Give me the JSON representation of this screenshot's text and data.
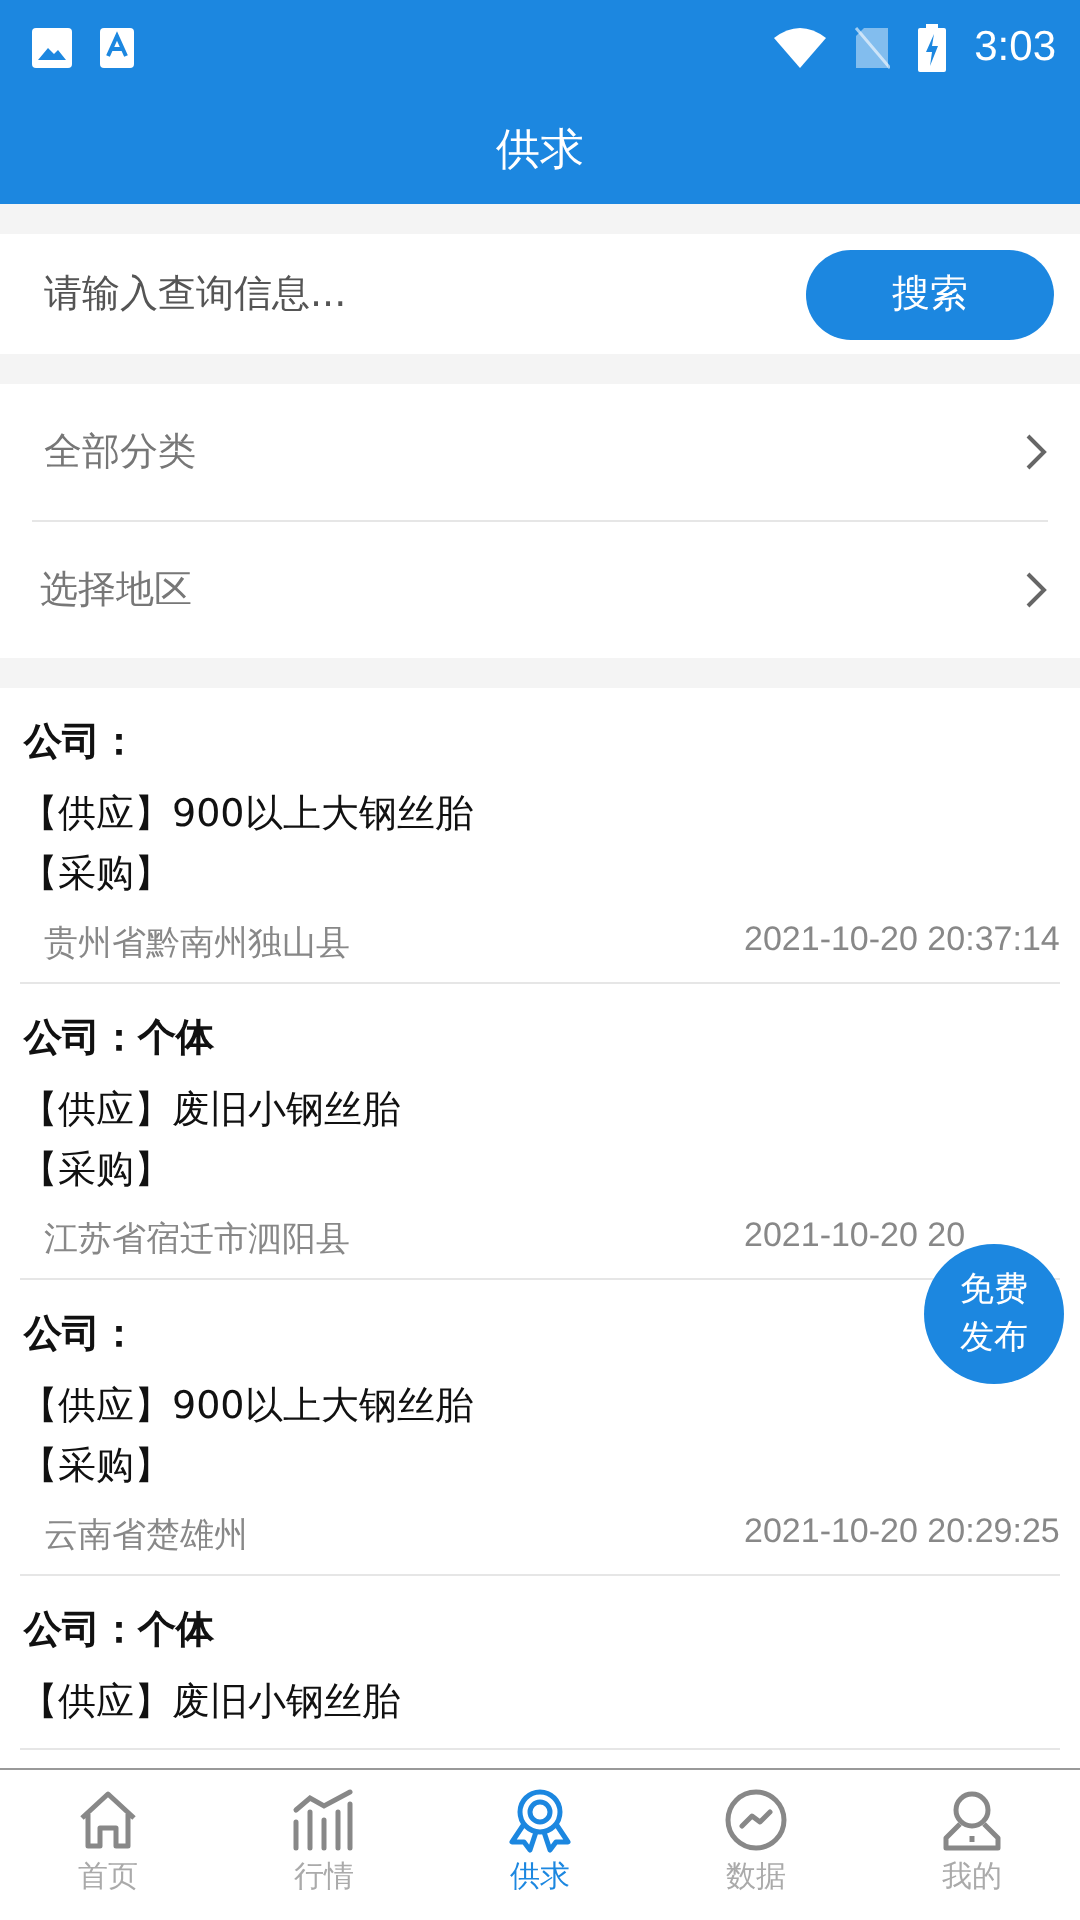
{
  "status_bar": {
    "time": "3:03"
  },
  "header": {
    "title": "供求"
  },
  "search": {
    "placeholder": "请输入查询信息...",
    "button": "搜索"
  },
  "filters": [
    {
      "label": "全部分类"
    },
    {
      "label": "选择地区"
    }
  ],
  "posts": [
    {
      "company_label": "公司：",
      "supply": "【供应】900以上大钢丝胎",
      "purchase": "【采购】",
      "location": "贵州省黔南州独山县",
      "time": "2021-10-20 20:37:14"
    },
    {
      "company_label": "公司：",
      "company": "个体",
      "supply": "【供应】废旧小钢丝胎",
      "purchase": "【采购】",
      "location": "江苏省宿迁市泗阳县",
      "time": "2021-10-20 20"
    },
    {
      "company_label": "公司：",
      "supply": "【供应】900以上大钢丝胎",
      "purchase": "【采购】",
      "location": "云南省楚雄州",
      "time": "2021-10-20 20:29:25"
    },
    {
      "company_label": "公司：",
      "company": "个体",
      "supply": "【供应】废旧小钢丝胎"
    }
  ],
  "fab": {
    "lines": [
      "免费",
      "发布"
    ]
  },
  "tabs": [
    {
      "label": "首页",
      "kind": "home",
      "selected": false
    },
    {
      "label": "行情",
      "kind": "chart",
      "selected": false
    },
    {
      "label": "供求",
      "kind": "medal",
      "selected": true
    },
    {
      "label": "数据",
      "kind": "trend",
      "selected": false
    },
    {
      "label": "我的",
      "kind": "user",
      "selected": false
    }
  ]
}
